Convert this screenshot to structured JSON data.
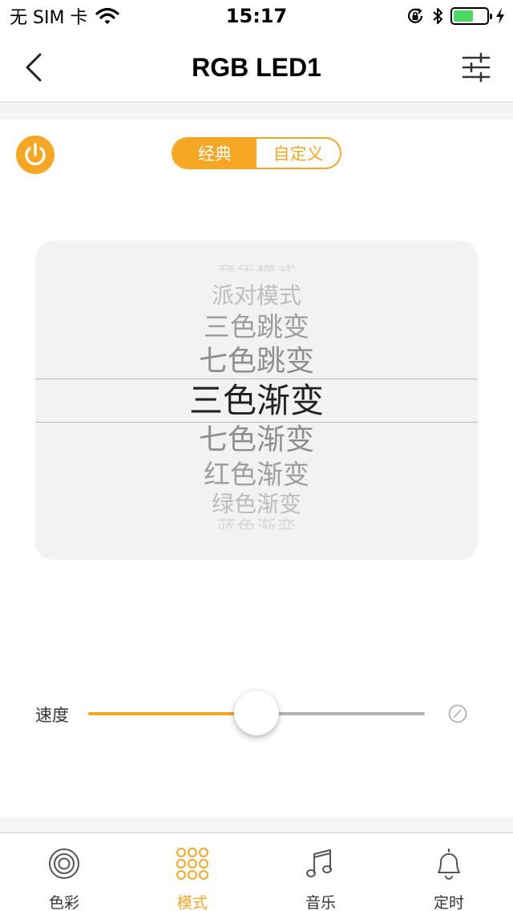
{
  "status_bar": {
    "carrier": "无 SIM 卡",
    "time": "15:17",
    "battery_level": 0.6
  },
  "nav": {
    "title": "RGB LED1",
    "back_icon": "chevron-left-icon",
    "settings_icon": "sliders-icon"
  },
  "mode_toggle": {
    "options": [
      "经典",
      "自定义"
    ],
    "selected": "经典"
  },
  "picker": {
    "items": [
      "音乐模式",
      "派对模式",
      "三色跳变",
      "七色跳变",
      "三色渐变",
      "七色渐变",
      "红色渐变",
      "绿色渐变",
      "蓝色渐变"
    ],
    "selected": "三色渐变"
  },
  "speed": {
    "label": "速度",
    "value": 0.5
  },
  "tabs": [
    {
      "label": "色彩",
      "icon": "color-wheel-icon",
      "active": false
    },
    {
      "label": "模式",
      "icon": "dots-grid-icon",
      "active": true
    },
    {
      "label": "音乐",
      "icon": "music-note-icon",
      "active": false
    },
    {
      "label": "定时",
      "icon": "bell-icon",
      "active": false
    }
  ],
  "colors": {
    "accent": "#f5a623",
    "battery": "#4cd964",
    "picker_bg": "#f2f2f2"
  }
}
